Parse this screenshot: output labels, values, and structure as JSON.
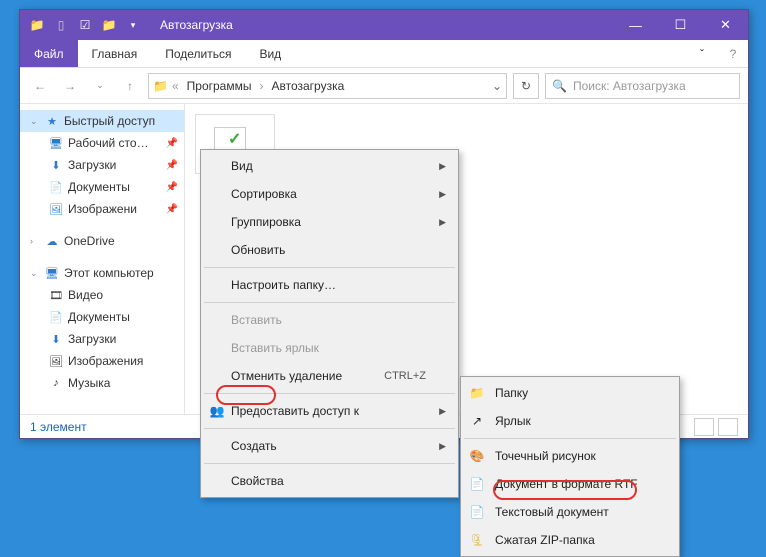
{
  "titlebar": {
    "title": "Автозагрузка"
  },
  "ribbon": {
    "file": "Файл",
    "home": "Главная",
    "share": "Поделиться",
    "view": "Вид",
    "drop": "ˇ"
  },
  "address": {
    "seg1": "Программы",
    "seg2": "Автозагрузка",
    "search_placeholder": "Поиск: Автозагрузка"
  },
  "tree": {
    "quick": "Быстрый доступ",
    "desktop": "Рабочий сто…",
    "downloads": "Загрузки",
    "documents": "Документы",
    "pictures": "Изображени",
    "onedrive": "OneDrive",
    "thispc": "Этот компьютер",
    "video": "Видео",
    "docs2": "Документы",
    "dl2": "Загрузки",
    "pics2": "Изображения",
    "music": "Музыка"
  },
  "status": {
    "count": "1 элемент"
  },
  "menu": {
    "view": "Вид",
    "sort": "Сортировка",
    "group": "Группировка",
    "refresh": "Обновить",
    "customize": "Настроить папку…",
    "paste": "Вставить",
    "pasteShortcut": "Вставить ярлык",
    "undo": "Отменить удаление",
    "undoShortcut": "CTRL+Z",
    "share": "Предоставить доступ к",
    "new": "Создать",
    "props": "Свойства"
  },
  "submenu": {
    "folder": "Папку",
    "shortcut": "Ярлык",
    "bitmap": "Точечный рисунок",
    "rtf": "Документ в формате RTF",
    "txt": "Текстовый документ",
    "zip": "Сжатая ZIP-папка"
  }
}
